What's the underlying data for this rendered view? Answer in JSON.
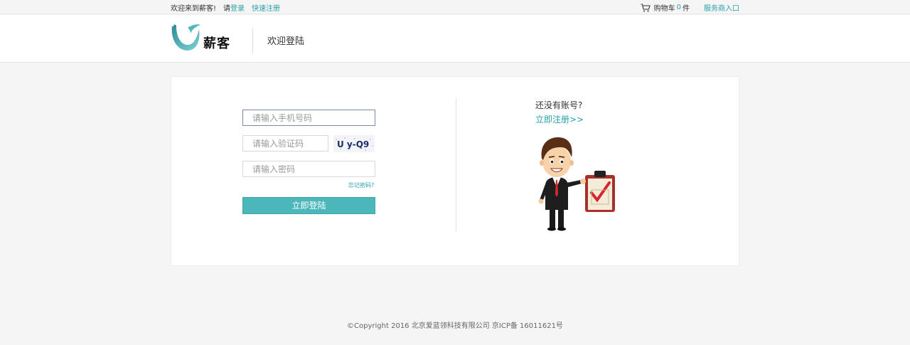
{
  "topbar": {
    "welcome": "欢迎来到薪客!",
    "please": "请",
    "login_link": "登录",
    "quick_register": "快速注册",
    "cart_label": "购物车",
    "cart_count": "0",
    "cart_unit": "件",
    "merchant_entry": "服务商入口"
  },
  "header": {
    "logo_text": "薪客",
    "title": "欢迎登陆"
  },
  "form": {
    "phone_placeholder": "请输入手机号码",
    "code_placeholder": "请输入验证码",
    "password_placeholder": "请输入密码",
    "captcha_text": "U y-Q9",
    "forgot_password": "忘记密码?",
    "submit_label": "立即登陆"
  },
  "register": {
    "question": "还没有账号?",
    "link": "立即注册>>"
  },
  "footer": {
    "copyright": "©Copyright 2016 北京爱蓝领科技有限公司 京ICP备 16011621号"
  },
  "colors": {
    "accent": "#28a1a9",
    "button": "#4cb7bb",
    "background": "#f5f5f5"
  }
}
